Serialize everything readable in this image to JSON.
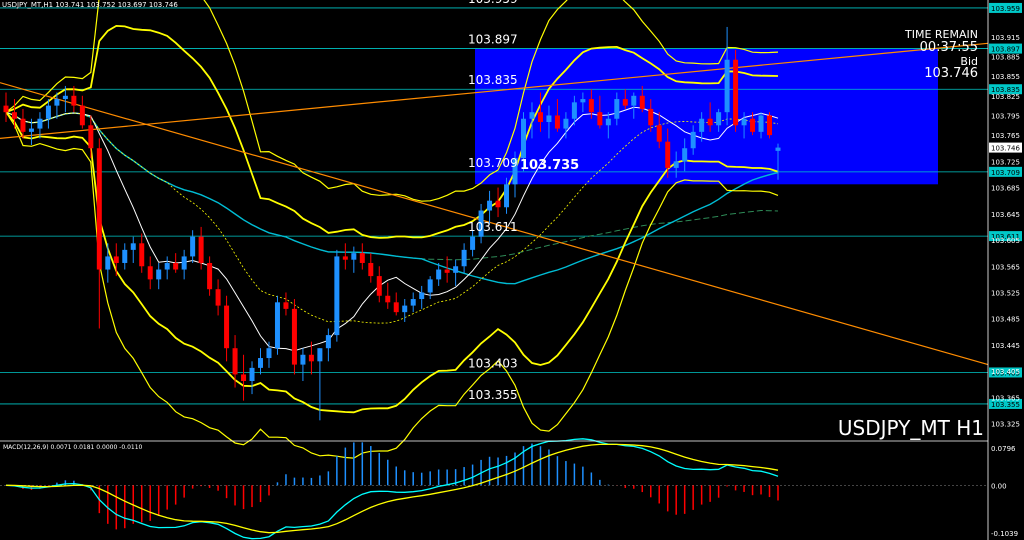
{
  "header": {
    "symbol_line": "USDJPY_MT,H1  103.741 103.752 103.697 103.746",
    "watermark": "USDJPY_MT H1",
    "time_remain_label": "TIME REMAIN",
    "time_remain_value": "00:37:55",
    "bid_label": "Bid",
    "bid_value": "103.746"
  },
  "colors": {
    "background": "#000000",
    "bull_candle": "#1e90ff",
    "bear_candle": "#ff0000",
    "bollinger": "#ffff00",
    "ma_white": "#ffffff",
    "ma_cyan": "#00bcd4",
    "ma_green": "#2e8b57",
    "trendline": "#ff8c00",
    "zone": "#0000ff",
    "level_line": "#00c8c8",
    "macd_signal": "#ffff00",
    "macd_main": "#00ffff"
  },
  "levels": [
    {
      "label": "103.959",
      "value": 103.959,
      "tag": "103.959"
    },
    {
      "label": "103.897",
      "value": 103.897,
      "tag": "103.897"
    },
    {
      "label": "103.835",
      "value": 103.835,
      "tag": "103.835"
    },
    {
      "label": "103.709",
      "value": 103.709,
      "tag": "103.709"
    },
    {
      "label": "103.611",
      "value": 103.611,
      "tag": "103.611"
    },
    {
      "label": "103.403",
      "value": 103.403,
      "tag": "103.403"
    },
    {
      "label": "103.355",
      "value": 103.355,
      "tag": "103.355"
    }
  ],
  "zone_label": "103.735",
  "current_price_tag": "103.746",
  "price_axis": {
    "min": 103.3,
    "max": 103.965,
    "ticks": [
      "103.915",
      "103.885",
      "103.855",
      "103.825",
      "103.795",
      "103.765",
      "103.725",
      "103.685",
      "103.645",
      "103.605",
      "103.565",
      "103.525",
      "103.485",
      "103.445",
      "103.405",
      "103.365",
      "103.325"
    ]
  },
  "macd": {
    "label": "MACD(12,26,9) 0.0071 0.0181 0.0000 -0.0110",
    "ticks": [
      "0.0796",
      "0.00",
      "-0.1039"
    ]
  },
  "chart_data": {
    "type": "candlestick",
    "title": "USDJPY_MT H1",
    "ylim": [
      103.3,
      103.965
    ],
    "series": [
      {
        "name": "candles",
        "ohlc": [
          [
            103.81,
            103.83,
            103.785,
            103.8
          ],
          [
            103.8,
            103.82,
            103.775,
            103.79
          ],
          [
            103.79,
            103.805,
            103.76,
            103.77
          ],
          [
            103.77,
            103.79,
            103.75,
            103.775
          ],
          [
            103.775,
            103.8,
            103.76,
            103.79
          ],
          [
            103.79,
            103.82,
            103.775,
            103.81
          ],
          [
            103.81,
            103.83,
            103.79,
            103.82
          ],
          [
            103.82,
            103.84,
            103.8,
            103.825
          ],
          [
            103.825,
            103.84,
            103.8,
            103.81
          ],
          [
            103.81,
            103.825,
            103.775,
            103.78
          ],
          [
            103.78,
            103.795,
            103.73,
            103.745
          ],
          [
            103.745,
            103.76,
            103.47,
            103.56
          ],
          [
            103.56,
            103.6,
            103.54,
            103.58
          ],
          [
            103.58,
            103.6,
            103.55,
            103.57
          ],
          [
            103.57,
            103.6,
            103.56,
            103.59
          ],
          [
            103.59,
            103.61,
            103.57,
            103.6
          ],
          [
            103.6,
            103.615,
            103.555,
            103.565
          ],
          [
            103.565,
            103.58,
            103.53,
            103.545
          ],
          [
            103.545,
            103.57,
            103.53,
            103.56
          ],
          [
            103.56,
            103.58,
            103.545,
            103.57
          ],
          [
            103.57,
            103.585,
            103.555,
            103.56
          ],
          [
            103.56,
            103.59,
            103.545,
            103.58
          ],
          [
            103.58,
            103.62,
            103.57,
            103.61
          ],
          [
            103.61,
            103.625,
            103.56,
            103.57
          ],
          [
            103.57,
            103.58,
            103.52,
            103.53
          ],
          [
            103.53,
            103.545,
            103.49,
            103.505
          ],
          [
            103.505,
            103.52,
            103.42,
            103.44
          ],
          [
            103.44,
            103.46,
            103.38,
            103.4
          ],
          [
            103.4,
            103.43,
            103.36,
            103.39
          ],
          [
            103.39,
            103.42,
            103.37,
            103.41
          ],
          [
            103.41,
            103.44,
            103.4,
            103.425
          ],
          [
            103.425,
            103.45,
            103.41,
            103.44
          ],
          [
            103.44,
            103.52,
            103.43,
            103.51
          ],
          [
            103.51,
            103.525,
            103.49,
            103.5
          ],
          [
            103.5,
            103.515,
            103.4,
            103.415
          ],
          [
            103.415,
            103.44,
            103.39,
            103.43
          ],
          [
            103.43,
            103.45,
            103.4,
            103.42
          ],
          [
            103.42,
            103.44,
            103.33,
            103.44
          ],
          [
            103.44,
            103.47,
            103.42,
            103.46
          ],
          [
            103.46,
            103.59,
            103.45,
            103.58
          ],
          [
            103.58,
            103.6,
            103.56,
            103.575
          ],
          [
            103.575,
            103.595,
            103.555,
            103.585
          ],
          [
            103.585,
            103.6,
            103.56,
            103.57
          ],
          [
            103.57,
            103.585,
            103.54,
            103.55
          ],
          [
            103.55,
            103.565,
            103.51,
            103.52
          ],
          [
            103.52,
            103.54,
            103.5,
            103.51
          ],
          [
            103.51,
            103.525,
            103.49,
            103.495
          ],
          [
            103.495,
            103.515,
            103.48,
            103.505
          ],
          [
            103.505,
            103.525,
            103.495,
            103.515
          ],
          [
            103.515,
            103.535,
            103.5,
            103.525
          ],
          [
            103.525,
            103.55,
            103.515,
            103.545
          ],
          [
            103.545,
            103.57,
            103.535,
            103.56
          ],
          [
            103.56,
            103.58,
            103.54,
            103.555
          ],
          [
            103.555,
            103.575,
            103.535,
            103.565
          ],
          [
            103.565,
            103.6,
            103.555,
            103.59
          ],
          [
            103.59,
            103.62,
            103.58,
            103.61
          ],
          [
            103.61,
            103.66,
            103.6,
            103.65
          ],
          [
            103.65,
            103.68,
            103.63,
            103.665
          ],
          [
            103.665,
            103.685,
            103.64,
            103.655
          ],
          [
            103.655,
            103.7,
            103.645,
            103.69
          ],
          [
            103.69,
            103.74,
            103.67,
            103.73
          ],
          [
            103.73,
            103.8,
            103.71,
            103.79
          ],
          [
            103.79,
            103.815,
            103.76,
            103.8
          ],
          [
            103.8,
            103.83,
            103.77,
            103.785
          ],
          [
            103.785,
            103.81,
            103.76,
            103.795
          ],
          [
            103.795,
            103.82,
            103.77,
            103.775
          ],
          [
            103.775,
            103.8,
            103.76,
            103.79
          ],
          [
            103.79,
            103.825,
            103.78,
            103.815
          ],
          [
            103.815,
            103.83,
            103.8,
            103.82
          ],
          [
            103.82,
            103.835,
            103.79,
            103.8
          ],
          [
            103.8,
            103.825,
            103.775,
            103.78
          ],
          [
            103.78,
            103.8,
            103.76,
            103.79
          ],
          [
            103.79,
            103.83,
            103.78,
            103.82
          ],
          [
            103.82,
            103.835,
            103.805,
            103.81
          ],
          [
            103.81,
            103.83,
            103.79,
            103.825
          ],
          [
            103.825,
            103.84,
            103.8,
            103.805
          ],
          [
            103.805,
            103.82,
            103.77,
            103.78
          ],
          [
            103.78,
            103.8,
            103.745,
            103.755
          ],
          [
            103.755,
            103.775,
            103.7,
            103.715
          ],
          [
            103.715,
            103.74,
            103.7,
            103.725
          ],
          [
            103.725,
            103.76,
            103.71,
            103.745
          ],
          [
            103.745,
            103.78,
            103.735,
            103.77
          ],
          [
            103.77,
            103.8,
            103.755,
            103.79
          ],
          [
            103.79,
            103.815,
            103.77,
            103.78
          ],
          [
            103.78,
            103.805,
            103.77,
            103.8
          ],
          [
            103.8,
            103.93,
            103.78,
            103.88
          ],
          [
            103.88,
            103.895,
            103.77,
            103.78
          ],
          [
            103.78,
            103.8,
            103.76,
            103.79
          ],
          [
            103.79,
            103.8,
            103.765,
            103.77
          ],
          [
            103.77,
            103.8,
            103.76,
            103.795
          ],
          [
            103.795,
            103.8,
            103.76,
            103.765
          ],
          [
            103.741,
            103.752,
            103.697,
            103.746
          ]
        ]
      }
    ]
  }
}
